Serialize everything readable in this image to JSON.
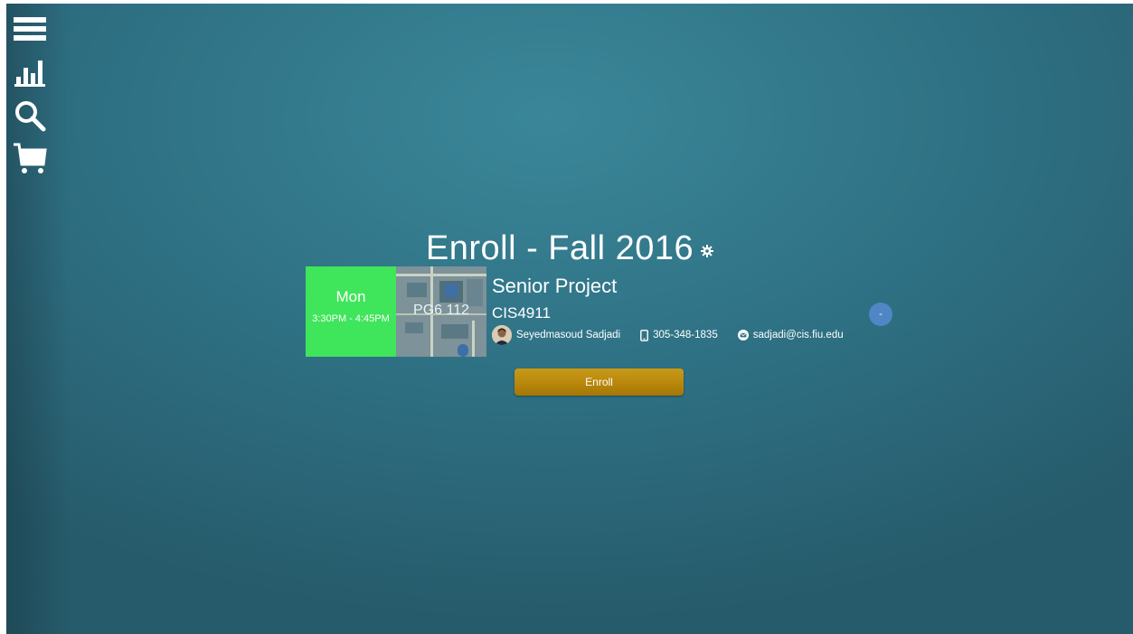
{
  "sidebar": {
    "items": [
      {
        "icon": "menu-icon"
      },
      {
        "icon": "bar-chart-icon"
      },
      {
        "icon": "search-icon"
      },
      {
        "icon": "cart-icon"
      }
    ]
  },
  "page": {
    "title": "Enroll - Fall 2016",
    "settings_icon": "gear-icon"
  },
  "course": {
    "day": "Mon",
    "time": "3:30PM - 4:45PM",
    "room": "PG6 112",
    "name": "Senior Project",
    "code": "CIS4911",
    "instructor": "Seyedmasoud Sadjadi",
    "phone": "305-348-1835",
    "email": "sadjadi@cis.fiu.edu",
    "remove_label": "-"
  },
  "actions": {
    "enroll_label": "Enroll"
  },
  "colors": {
    "time_block": "#3fe55a",
    "enroll_button": "#b8870c",
    "remove_button": "#4f86c6",
    "background": "#2e6f82"
  }
}
